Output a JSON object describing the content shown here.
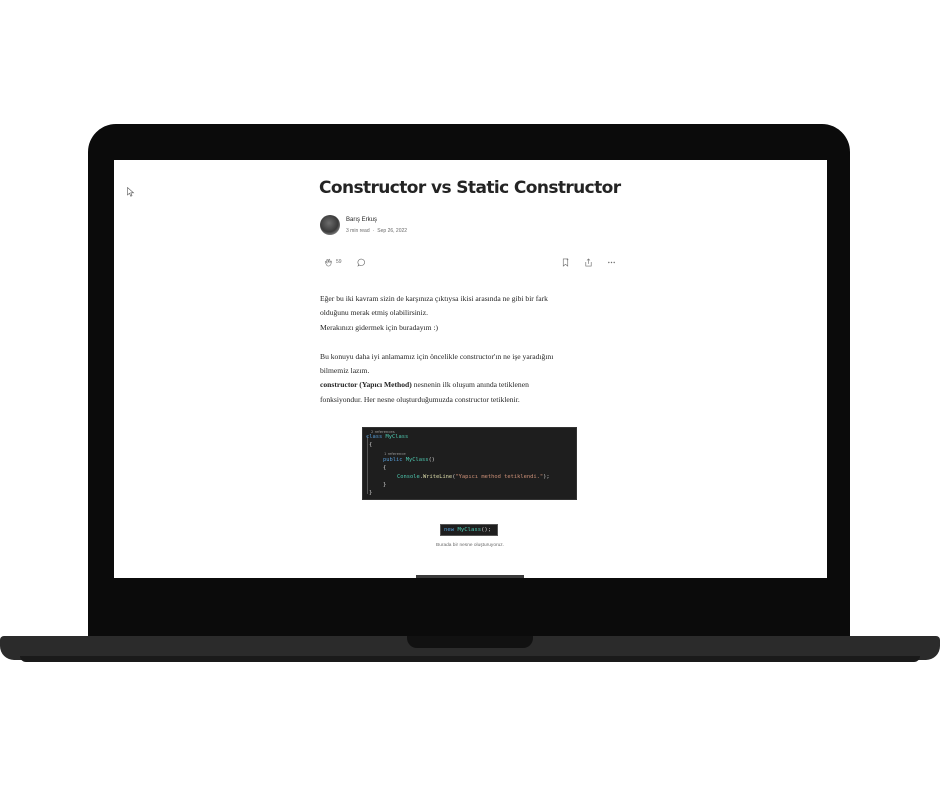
{
  "article": {
    "title": "Constructor vs Static Constructor",
    "author": "Barış Erkuş",
    "read_time": "3 min read",
    "date": "Sep 26, 2022",
    "claps": "59",
    "paragraphs": {
      "p1_line1": "Eğer bu iki kavram sizin de karşınıza çıktıysa ikisi arasında ne gibi bir fark",
      "p1_line2": "olduğunu merak etmiş olabilirsiniz.",
      "p1_line3": "Merakınızı gidermek için buradayım :)",
      "p2_line1": "Bu konuyu daha iyi anlamamız için öncelikle constructor'ın ne işe yaradığını",
      "p2_line2": "bilmemiz lazım.",
      "p3_bold": "constructor (Yapıcı Method)",
      "p3_rest": " nesnenin ilk oluşum anında tetiklenen",
      "p3_line2": "fonksiyondur. Her nesne oluşturduğumuzda constructor tetiklenir."
    },
    "code_block": {
      "hint1": "2 references",
      "line1_kw": "class ",
      "line1_ty": "MyClass",
      "line2": "{",
      "hint2": "1 reference",
      "line3_kw": "public ",
      "line3_fn": "MyClass",
      "line3_rest": "()",
      "line4": "{",
      "line5_ty": "Console",
      "line5_dot": ".",
      "line5_fn": "WriteLine",
      "line5_open": "(",
      "line5_str": "\"Yapıcı method tetiklendi.\"",
      "line5_close": ");",
      "line6": "}",
      "line7": "}"
    },
    "inline_code": {
      "kw": "new ",
      "ty": "MyClass",
      "rest": "();"
    },
    "caption": "Burada bir nesne oluşturuyoruz."
  },
  "colors": {
    "laptop_bezel": "#0b0b0b",
    "laptop_base": "#2b2b2b",
    "code_bg": "#1e1e1e",
    "keyword": "#569cd6",
    "type": "#4ec9b0",
    "string": "#ce9178"
  },
  "icons": [
    "cursor-icon",
    "clap-icon",
    "comment-icon",
    "bookmark-icon",
    "share-icon",
    "more-icon"
  ]
}
